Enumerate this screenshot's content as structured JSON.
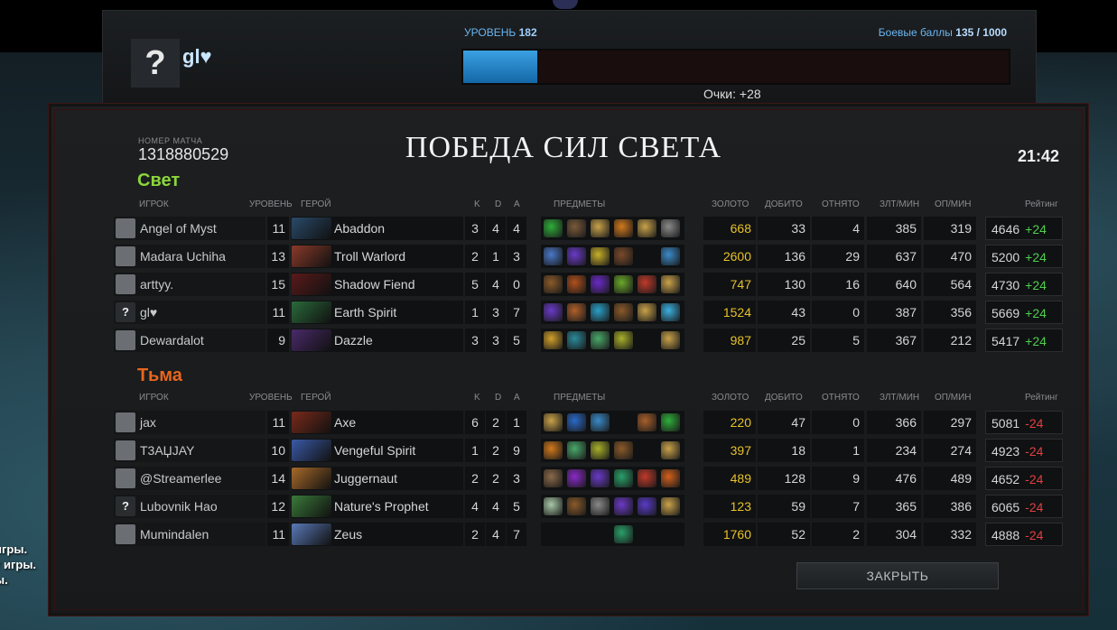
{
  "top": {
    "avatar_symbol": "?",
    "player_name": "gl♥",
    "level_label": "УРОВЕНЬ",
    "level_value": "182",
    "battle_label": "Боевые баллы",
    "battle_value": "135 / 1000",
    "battle_progress": 0.135,
    "points_text": "Очки: +28"
  },
  "match": {
    "id_label": "НОМЕР МАТЧА",
    "id": "1318880529",
    "result": "ПОБЕДА СИЛ СВЕТА",
    "duration": "21:42"
  },
  "headers": {
    "player": "ИГРОК",
    "level": "УРОВЕНЬ",
    "hero": "ГЕРОЙ",
    "k": "K",
    "d": "D",
    "a": "A",
    "items": "ПРЕДМЕТЫ",
    "gold": "ЗОЛОТО",
    "lh": "ДОБИТО",
    "dn": "ОТНЯТО",
    "gpm": "ЗЛТ/МИН",
    "xpm": "ОП/МИН",
    "rating": "Рейтинг"
  },
  "radiant": {
    "title": "Свет",
    "color": "#8bd63a",
    "players": [
      {
        "name": "Angel of Myst",
        "level": "11",
        "hero": "Abaddon",
        "k": "3",
        "d": "4",
        "a": "4",
        "gold": "668",
        "lh": "33",
        "dn": "4",
        "gpm": "385",
        "xpm": "319",
        "rating": "4646",
        "delta": "+24",
        "avatar": "",
        "hero_color": "#2a4a6a",
        "items": [
          "#2fae3a",
          "#7a5a3a",
          "#c9a24a",
          "#d2791c",
          "#c9a24a",
          "#8a8a8a"
        ]
      },
      {
        "name": "Madara Uchiha",
        "level": "13",
        "hero": "Troll Warlord",
        "k": "2",
        "d": "1",
        "a": "3",
        "gold": "2600",
        "lh": "136",
        "dn": "29",
        "gpm": "637",
        "xpm": "470",
        "rating": "5200",
        "delta": "+24",
        "avatar": "",
        "hero_color": "#8a3a2a",
        "items": [
          "#4a78c8",
          "#6a3ac8",
          "#c8b02a",
          "#7a4a2a",
          "",
          "#3a8ac8"
        ]
      },
      {
        "name": "arttyy.",
        "level": "15",
        "hero": "Shadow Fiend",
        "k": "5",
        "d": "4",
        "a": "0",
        "gold": "747",
        "lh": "130",
        "dn": "16",
        "gpm": "640",
        "xpm": "564",
        "rating": "4730",
        "delta": "+24",
        "avatar": "",
        "hero_color": "#5a1a1a",
        "items": [
          "#8a5a2a",
          "#b0501c",
          "#6a2ac8",
          "#6aa82a",
          "#c03a2a",
          "#c9a24a"
        ]
      },
      {
        "name": "gl♥",
        "level": "11",
        "hero": "Earth Spirit",
        "k": "1",
        "d": "3",
        "a": "7",
        "gold": "1524",
        "lh": "43",
        "dn": "0",
        "gpm": "387",
        "xpm": "356",
        "rating": "5669",
        "delta": "+24",
        "avatar": "?",
        "hero_color": "#2a6a3a",
        "items": [
          "#6a3ac8",
          "#b0602a",
          "#2aa0c8",
          "#8a5a2a",
          "#c9a24a",
          "#3ab0e0"
        ]
      },
      {
        "name": "Dewardalot",
        "level": "9",
        "hero": "Dazzle",
        "k": "3",
        "d": "3",
        "a": "5",
        "gold": "987",
        "lh": "25",
        "dn": "5",
        "gpm": "367",
        "xpm": "212",
        "rating": "5417",
        "delta": "+24",
        "avatar": "",
        "hero_color": "#4a2a6a",
        "items": [
          "#d2a02a",
          "#2a8a9a",
          "#4aa86a",
          "#a8b02a",
          "",
          "#c9a24a"
        ]
      }
    ]
  },
  "dire": {
    "title": "Тьма",
    "color": "#e8661c",
    "players": [
      {
        "name": "jax",
        "level": "11",
        "hero": "Axe",
        "k": "6",
        "d": "2",
        "a": "1",
        "gold": "220",
        "lh": "47",
        "dn": "0",
        "gpm": "366",
        "xpm": "297",
        "rating": "5081",
        "delta": "-24",
        "avatar": "",
        "hero_color": "#7a2a1a",
        "items": [
          "#c9a24a",
          "#2a6ac8",
          "#3a8ac8",
          "",
          "#a8602a",
          "#2fae3a"
        ]
      },
      {
        "name": "T3AЏJAY",
        "level": "10",
        "hero": "Vengeful Spirit",
        "k": "1",
        "d": "2",
        "a": "9",
        "gold": "397",
        "lh": "18",
        "dn": "1",
        "gpm": "234",
        "xpm": "274",
        "rating": "4923",
        "delta": "-24",
        "avatar": "",
        "hero_color": "#3a5aa8",
        "items": [
          "#d2791c",
          "#4aa86a",
          "#a8b02a",
          "#8a5a2a",
          "",
          "#c9a24a"
        ]
      },
      {
        "name": "@Streamerlee",
        "level": "14",
        "hero": "Juggernaut",
        "k": "2",
        "d": "2",
        "a": "3",
        "gold": "489",
        "lh": "128",
        "dn": "9",
        "gpm": "476",
        "xpm": "489",
        "rating": "4652",
        "delta": "-24",
        "avatar": "",
        "hero_color": "#a86a2a",
        "items": [
          "#8a6a4a",
          "#8a2ac8",
          "#6a3ac8",
          "#2aa06a",
          "#c03a2a",
          "#d2601c"
        ]
      },
      {
        "name": "Lubovnik Hao",
        "level": "12",
        "hero": "Nature's Prophet",
        "k": "4",
        "d": "4",
        "a": "5",
        "gold": "123",
        "lh": "59",
        "dn": "7",
        "gpm": "365",
        "xpm": "386",
        "rating": "6065",
        "delta": "-24",
        "avatar": "?",
        "hero_color": "#3a7a3a",
        "items": [
          "#a8c8a8",
          "#8a5a2a",
          "#8a8a8a",
          "#6a3ac8",
          "#5a3ac8",
          "#c9a24a"
        ]
      },
      {
        "name": "Mumindalen",
        "level": "11",
        "hero": "Zeus",
        "k": "2",
        "d": "4",
        "a": "7",
        "gold": "1760",
        "lh": "52",
        "dn": "2",
        "gpm": "304",
        "xpm": "332",
        "rating": "4888",
        "delta": "-24",
        "avatar": "",
        "hero_color": "#5a7ab8",
        "items": [
          "",
          "",
          "",
          "#2aa06a",
          "",
          ""
        ]
      }
    ]
  },
  "close_label": "ЗАКРЫТЬ",
  "bg_chat": [
    "игры.",
    "т игры.",
    "ы."
  ]
}
